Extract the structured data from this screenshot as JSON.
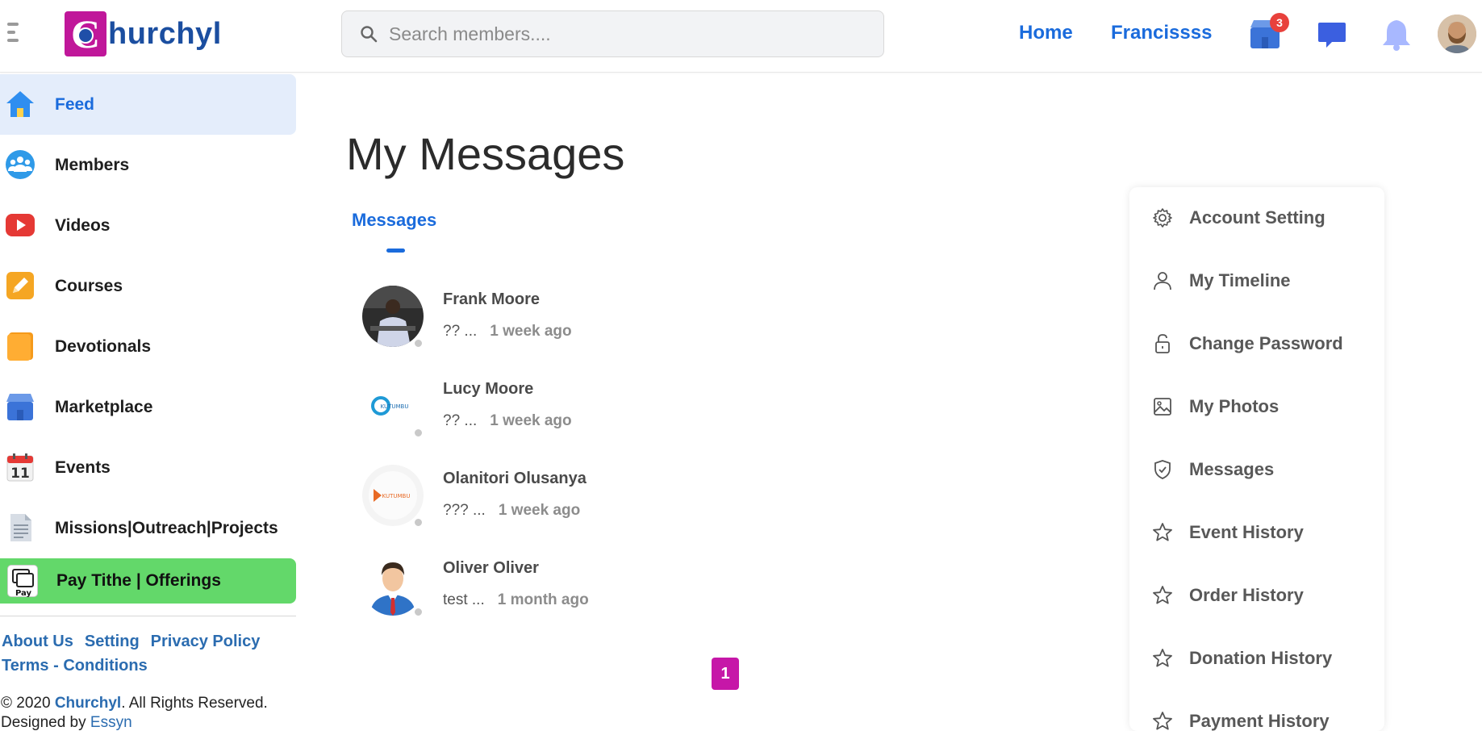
{
  "header": {
    "logo_initial": "C",
    "logo_text": "hurchyl",
    "search_placeholder": "Search members....",
    "nav_home": "Home",
    "nav_user": "Francissss",
    "marketplace_badge": "3"
  },
  "sidebar": {
    "items": [
      {
        "label": "Feed"
      },
      {
        "label": "Members"
      },
      {
        "label": "Videos"
      },
      {
        "label": "Courses"
      },
      {
        "label": "Devotionals"
      },
      {
        "label": "Marketplace"
      },
      {
        "label": "Events"
      },
      {
        "label": "Missions|Outreach|Projects"
      }
    ],
    "events_day": "11",
    "pay_icon_text": "Pay",
    "pay_label": "Pay Tithe | Offerings",
    "footer_links": [
      "About Us",
      "Setting",
      "Privacy Policy",
      "Terms - Conditions"
    ],
    "copyright_prefix": "© 2020 ",
    "copyright_brand": "Churchyl",
    "copyright_suffix": ". All Rights Reserved.",
    "designed_by": "Designed by ",
    "designer": "Essyn"
  },
  "main": {
    "title": "My Messages",
    "tab_label": "Messages",
    "messages": [
      {
        "name": "Frank Moore",
        "preview": "?? ...",
        "time": "1 week ago"
      },
      {
        "name": "Lucy Moore",
        "preview": "?? ...",
        "time": "1 week ago"
      },
      {
        "name": "Olanitori Olusanya",
        "preview": "??? ...",
        "time": "1 week ago"
      },
      {
        "name": "Oliver Oliver",
        "preview": "test ...",
        "time": "1 month ago"
      }
    ],
    "logo_text_1": "KUTUMBU",
    "logo_text_2": "KUTUMBU",
    "page_number": "1"
  },
  "right_menu": {
    "items": [
      {
        "label": "Account Setting",
        "icon": "gear-icon"
      },
      {
        "label": "My Timeline",
        "icon": "user-icon"
      },
      {
        "label": "Change Password",
        "icon": "unlock-icon"
      },
      {
        "label": "My Photos",
        "icon": "image-icon"
      },
      {
        "label": "Messages",
        "icon": "shield-icon"
      },
      {
        "label": "Event History",
        "icon": "star-icon"
      },
      {
        "label": "Order History",
        "icon": "star-icon"
      },
      {
        "label": "Donation History",
        "icon": "star-icon"
      },
      {
        "label": "Payment History",
        "icon": "star-icon"
      }
    ]
  },
  "colors": {
    "brand_blue": "#1a6bdc",
    "brand_magenta": "#c0179a",
    "pay_green": "#63d86a",
    "active_bg": "#e4edfb",
    "badge_red": "#e8413c"
  }
}
